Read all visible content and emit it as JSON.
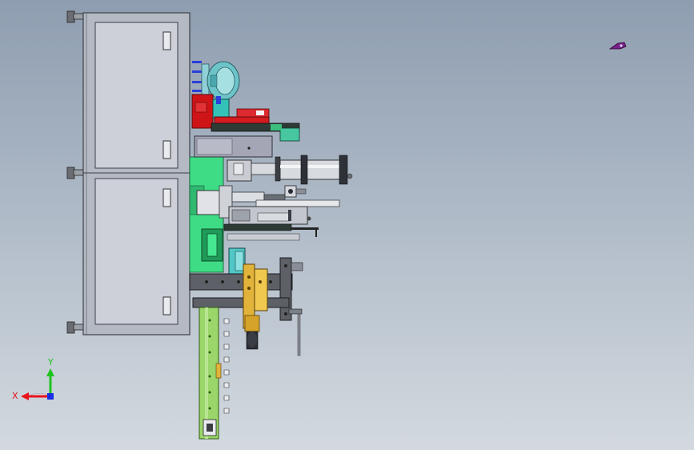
{
  "triad": {
    "x_label": "X",
    "y_label": "Y",
    "x_color": "#e8141c",
    "y_color": "#1ec41e",
    "z_color": "#1a2fe0"
  },
  "colors": {
    "cabinet": "#c9ccd6",
    "cabinet_edge": "#5a5e66",
    "plate_green": "#3fdc86",
    "rail_green": "#9bd66a",
    "frame_grey": "#5d6066",
    "cyan_part": "#5fc8c8",
    "red_part": "#d0161a",
    "cylinder": "#c8ccd2",
    "yellow_part": "#e2b33a"
  },
  "icons": {
    "orientation_triad": "xyz-triad-icon",
    "cursor": "pointer-cursor-icon"
  }
}
